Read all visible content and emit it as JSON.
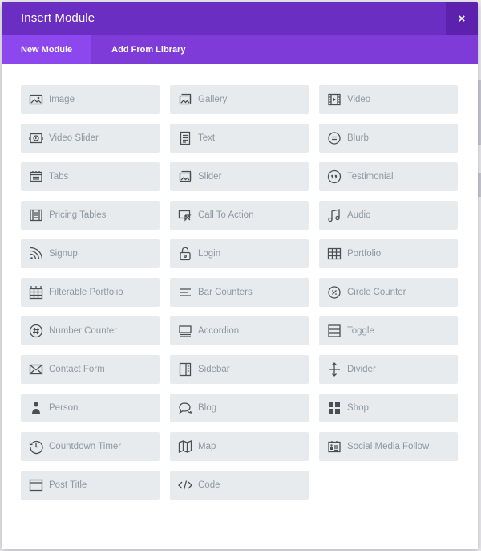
{
  "dialog": {
    "title": "Insert Module",
    "close_label": "×"
  },
  "tabs": [
    {
      "label": "New Module",
      "active": true
    },
    {
      "label": "Add From Library",
      "active": false
    }
  ],
  "modules": [
    {
      "label": "Image",
      "icon": "image-icon"
    },
    {
      "label": "Gallery",
      "icon": "gallery-icon"
    },
    {
      "label": "Video",
      "icon": "video-icon"
    },
    {
      "label": "Video Slider",
      "icon": "video-slider-icon"
    },
    {
      "label": "Text",
      "icon": "text-icon"
    },
    {
      "label": "Blurb",
      "icon": "blurb-icon"
    },
    {
      "label": "Tabs",
      "icon": "tabs-icon"
    },
    {
      "label": "Slider",
      "icon": "slider-icon"
    },
    {
      "label": "Testimonial",
      "icon": "testimonial-icon"
    },
    {
      "label": "Pricing Tables",
      "icon": "pricing-tables-icon"
    },
    {
      "label": "Call To Action",
      "icon": "call-to-action-icon"
    },
    {
      "label": "Audio",
      "icon": "audio-icon"
    },
    {
      "label": "Signup",
      "icon": "signup-icon"
    },
    {
      "label": "Login",
      "icon": "login-icon"
    },
    {
      "label": "Portfolio",
      "icon": "portfolio-icon"
    },
    {
      "label": "Filterable Portfolio",
      "icon": "filterable-portfolio-icon"
    },
    {
      "label": "Bar Counters",
      "icon": "bar-counters-icon"
    },
    {
      "label": "Circle Counter",
      "icon": "circle-counter-icon"
    },
    {
      "label": "Number Counter",
      "icon": "number-counter-icon"
    },
    {
      "label": "Accordion",
      "icon": "accordion-icon"
    },
    {
      "label": "Toggle",
      "icon": "toggle-icon"
    },
    {
      "label": "Contact Form",
      "icon": "contact-form-icon"
    },
    {
      "label": "Sidebar",
      "icon": "sidebar-icon"
    },
    {
      "label": "Divider",
      "icon": "divider-icon"
    },
    {
      "label": "Person",
      "icon": "person-icon"
    },
    {
      "label": "Blog",
      "icon": "blog-icon"
    },
    {
      "label": "Shop",
      "icon": "shop-icon"
    },
    {
      "label": "Countdown Timer",
      "icon": "countdown-timer-icon"
    },
    {
      "label": "Map",
      "icon": "map-icon"
    },
    {
      "label": "Social Media Follow",
      "icon": "social-media-follow-icon"
    },
    {
      "label": "Post Title",
      "icon": "post-title-icon"
    },
    {
      "label": "Code",
      "icon": "code-icon"
    }
  ],
  "colors": {
    "header": "#6a2ec2",
    "tab_bar": "#7e3bd8",
    "active_tab": "#8c47ee",
    "module_bg": "#e8ebee",
    "module_text": "#8e98a2"
  }
}
